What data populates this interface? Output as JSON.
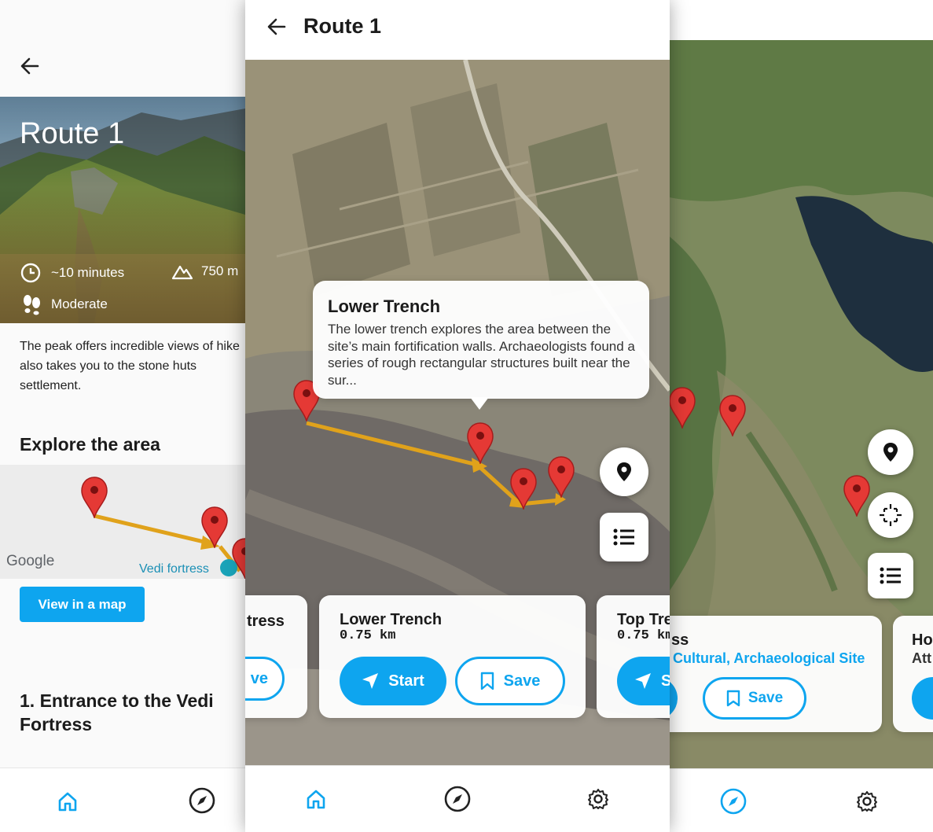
{
  "screen1": {
    "hero_title": "Route 1",
    "duration": "~10 minutes",
    "elevation": "750 m",
    "difficulty": "Moderate",
    "description": "The peak offers incredible views of hike also takes you to the stone huts settlement.",
    "explore_heading": "Explore the area",
    "map_google_label": "Google",
    "map_place_label": "Vedi fortress",
    "view_map_button": "View in a map",
    "section_heading": "1. Entrance to the Vedi Fortress"
  },
  "screen2": {
    "title": "Route 1",
    "popup": {
      "title": "Lower Trench",
      "body": "The lower trench explores the area between the site’s main fortification walls. Archaeologists found a series of rough rectangular structures built near the sur..."
    },
    "cards": [
      {
        "title": "tress",
        "save_label": "ve"
      },
      {
        "title": "Lower Trench",
        "distance": "0.75 km",
        "start_label": "Start",
        "save_label": "Save"
      },
      {
        "title": "Top Tre",
        "distance": "0.75 km",
        "start_label": "S"
      }
    ]
  },
  "screen3": {
    "card_title": "ss",
    "card_category": "Cultural, Archaeological Site",
    "save_label": "Save",
    "next_card_title": "Ho",
    "next_card_sub": "Att"
  },
  "icons": {
    "back": "arrow-left-icon",
    "clock": "clock-icon",
    "mountain": "mountain-icon",
    "footsteps": "footsteps-icon",
    "home": "home-icon",
    "compass": "compass-icon",
    "settings": "gear-icon",
    "location": "location-pin-icon",
    "list": "list-icon",
    "recenter": "recenter-icon",
    "navigate": "navigation-arrow-icon",
    "bookmark": "bookmark-icon"
  },
  "colors": {
    "accent": "#0ea5ef",
    "pin": "#e53935",
    "route": "#e0a21b"
  }
}
